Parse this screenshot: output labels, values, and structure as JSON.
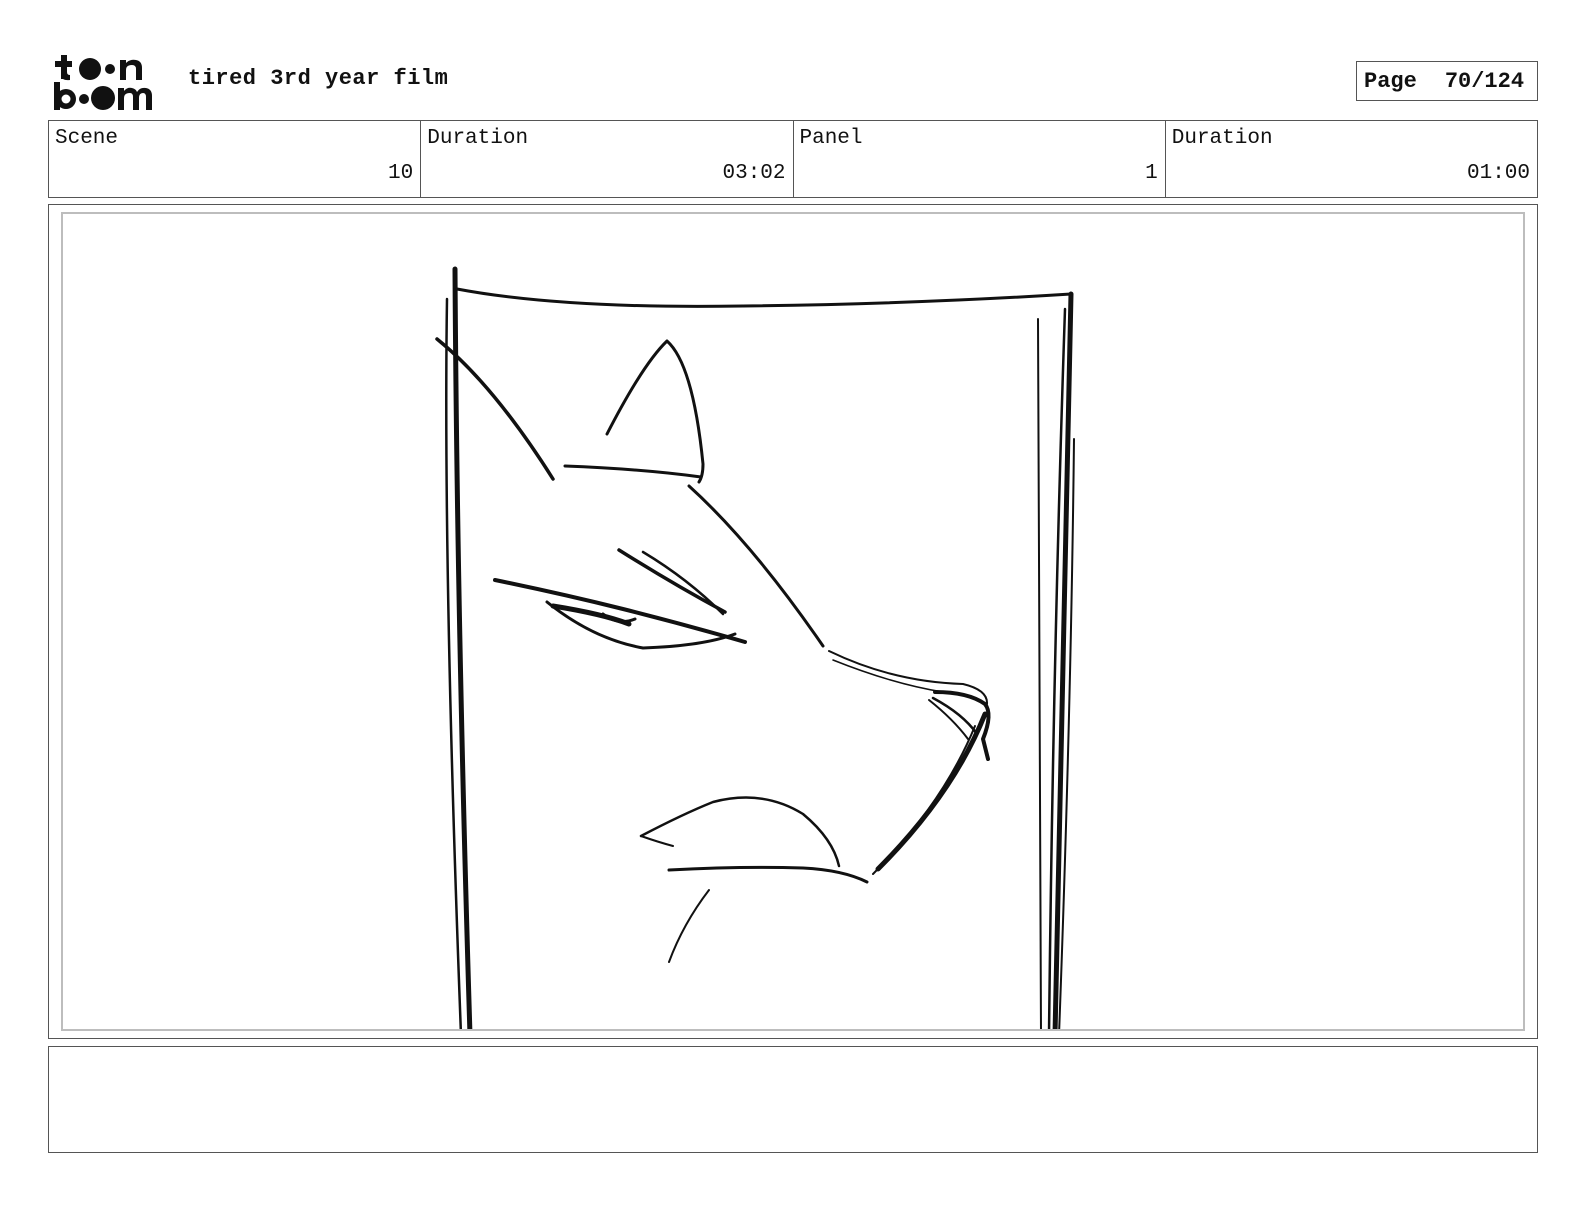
{
  "header": {
    "film_title": "tired 3rd year film",
    "logo": "toon boom",
    "page_label": "Page",
    "page_value": "70/124"
  },
  "info": [
    {
      "label": "Scene",
      "value": "10"
    },
    {
      "label": "Duration",
      "value": "03:02"
    },
    {
      "label": "Panel",
      "value": "1"
    },
    {
      "label": "Duration",
      "value": "01:00"
    }
  ],
  "panel": {
    "sketch": "fox-portrait-sketch"
  },
  "caption": {
    "text": ""
  }
}
